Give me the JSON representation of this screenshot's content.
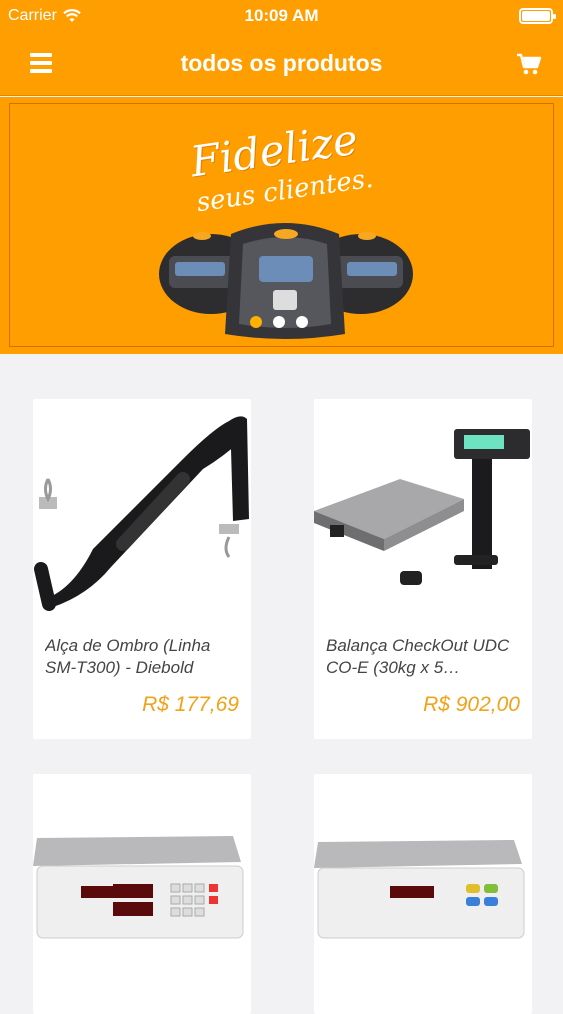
{
  "status_bar": {
    "carrier": "Carrier",
    "time": "10:09 AM"
  },
  "nav": {
    "title": "todos os produtos",
    "menu_icon": "menu-icon",
    "cart_icon": "cart-icon"
  },
  "banner": {
    "line1": "Fidelize",
    "line2": "seus clientes.",
    "active_slide": 0,
    "slide_count": 3
  },
  "colors": {
    "brand": "#ff9e00",
    "price": "#f0a318",
    "background": "#f2f2f4"
  },
  "products": [
    {
      "name": "Alça de Ombro (Linha SM-T300) - Diebold",
      "price": "R$ 177,69"
    },
    {
      "name": "Balança CheckOut UDC CO-E (30kg x 5…",
      "price": "R$ 902,00"
    },
    {
      "name": "",
      "price": ""
    },
    {
      "name": "",
      "price": ""
    }
  ]
}
